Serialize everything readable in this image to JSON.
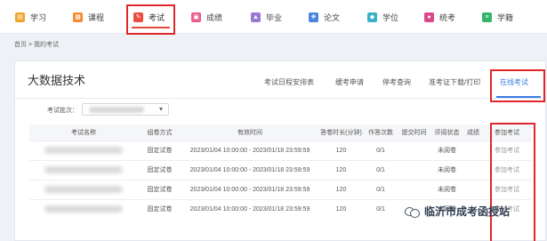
{
  "nav": {
    "items": [
      {
        "label": "学习",
        "icon": "study-icon",
        "color": "#f0a22e"
      },
      {
        "label": "课程",
        "icon": "course-icon",
        "color": "#f28b30"
      },
      {
        "label": "考试",
        "icon": "exam-icon",
        "color": "#ea4c3d"
      },
      {
        "label": "成绩",
        "icon": "grade-icon",
        "color": "#e85e8c"
      },
      {
        "label": "毕业",
        "icon": "graduation-icon",
        "color": "#9a79d6"
      },
      {
        "label": "论文",
        "icon": "thesis-icon",
        "color": "#4a86e0"
      },
      {
        "label": "学位",
        "icon": "degree-icon",
        "color": "#3ab0c8"
      },
      {
        "label": "统考",
        "icon": "unified-exam-icon",
        "color": "#d84a8a"
      },
      {
        "label": "学籍",
        "icon": "status-icon",
        "color": "#34b36a"
      }
    ],
    "active_index": 2
  },
  "breadcrumb": "首页 > 我的考试",
  "course_title": "大数据技术",
  "tabs": [
    "考试日程安排表",
    "缓考申请",
    "停考查询",
    "准考证下载/打印",
    "在线考试"
  ],
  "active_tab": "在线考试",
  "batch": {
    "label": "考试批次："
  },
  "table": {
    "headers": [
      "考试名称",
      "组卷方式",
      "有效时间",
      "答卷时长(分钟)",
      "作答次数",
      "提交时间",
      "评阅状态",
      "成绩",
      "参加考试"
    ],
    "rows": [
      {
        "method": "固定试卷",
        "time": "2023/01/04 10:00:00 - 2023/01/18 23:59:59",
        "duration": "120",
        "attempts": "0/1",
        "submit": "",
        "status": "未阅卷",
        "score": "",
        "action": "参加考试"
      },
      {
        "method": "固定试卷",
        "time": "2023/01/04 10:00:00 - 2023/01/18 23:59:59",
        "duration": "120",
        "attempts": "0/1",
        "submit": "",
        "status": "未阅卷",
        "score": "",
        "action": "参加考试"
      },
      {
        "method": "固定试卷",
        "time": "2023/01/04 10:00:00 - 2023/01/18 23:59:59",
        "duration": "120",
        "attempts": "0/1",
        "submit": "",
        "status": "未阅卷",
        "score": "",
        "action": "参加考试"
      },
      {
        "method": "固定试卷",
        "time": "2023/01/04 10:00:00 - 2023/01/18 23:59:59",
        "duration": "120",
        "attempts": "0/1",
        "submit": "",
        "status": "未阅卷",
        "score": "",
        "action": "参加考试"
      }
    ]
  },
  "watermark": "临沂市成考函授站",
  "colors": {
    "accent": "#3a7be0",
    "highlight": "#e0262b",
    "nav_active": "#e84a3c"
  }
}
